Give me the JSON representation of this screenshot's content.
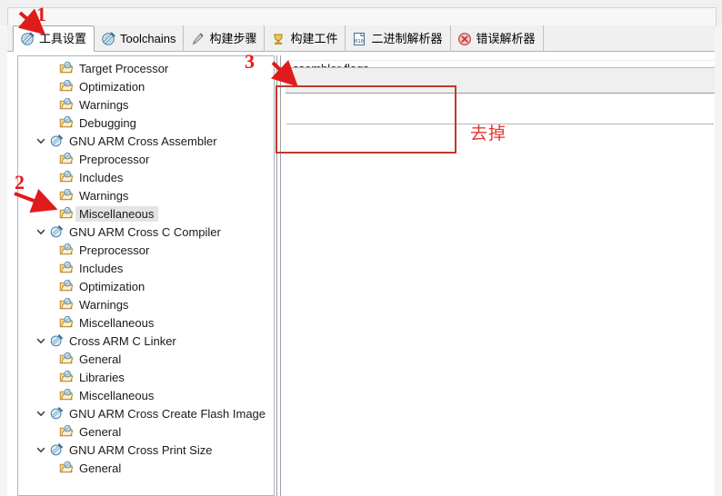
{
  "tabs": [
    {
      "label": "工具设置",
      "icon": "tool-settings-icon",
      "selected": true
    },
    {
      "label": "Toolchains",
      "icon": "toolchains-icon",
      "selected": false
    },
    {
      "label": "构建步骤",
      "icon": "build-steps-icon",
      "selected": false
    },
    {
      "label": "构建工件",
      "icon": "build-artifact-icon",
      "selected": false
    },
    {
      "label": "二进制解析器",
      "icon": "binary-parser-icon",
      "selected": false
    },
    {
      "label": "错误解析器",
      "icon": "error-parser-icon",
      "selected": false
    }
  ],
  "tree": [
    {
      "label": "Target Processor",
      "level": 2,
      "icon": "folder-icon",
      "twisty": "none",
      "selected": false
    },
    {
      "label": "Optimization",
      "level": 2,
      "icon": "folder-icon",
      "twisty": "none",
      "selected": false
    },
    {
      "label": "Warnings",
      "level": 2,
      "icon": "folder-icon",
      "twisty": "none",
      "selected": false
    },
    {
      "label": "Debugging",
      "level": 2,
      "icon": "folder-icon",
      "twisty": "none",
      "selected": false
    },
    {
      "label": "GNU ARM Cross Assembler",
      "level": 1,
      "icon": "toolchain-icon",
      "twisty": "expanded",
      "selected": false
    },
    {
      "label": "Preprocessor",
      "level": 2,
      "icon": "folder-icon",
      "twisty": "none",
      "selected": false
    },
    {
      "label": "Includes",
      "level": 2,
      "icon": "folder-icon",
      "twisty": "none",
      "selected": false
    },
    {
      "label": "Warnings",
      "level": 2,
      "icon": "folder-icon",
      "twisty": "none",
      "selected": false
    },
    {
      "label": "Miscellaneous",
      "level": 2,
      "icon": "folder-icon",
      "twisty": "none",
      "selected": true
    },
    {
      "label": "GNU ARM Cross C Compiler",
      "level": 1,
      "icon": "toolchain-icon",
      "twisty": "expanded",
      "selected": false
    },
    {
      "label": "Preprocessor",
      "level": 2,
      "icon": "folder-icon",
      "twisty": "none",
      "selected": false
    },
    {
      "label": "Includes",
      "level": 2,
      "icon": "folder-icon",
      "twisty": "none",
      "selected": false
    },
    {
      "label": "Optimization",
      "level": 2,
      "icon": "folder-icon",
      "twisty": "none",
      "selected": false
    },
    {
      "label": "Warnings",
      "level": 2,
      "icon": "folder-icon",
      "twisty": "none",
      "selected": false
    },
    {
      "label": "Miscellaneous",
      "level": 2,
      "icon": "folder-icon",
      "twisty": "none",
      "selected": false
    },
    {
      "label": "Cross ARM C Linker",
      "level": 1,
      "icon": "toolchain-icon",
      "twisty": "expanded",
      "selected": false
    },
    {
      "label": "General",
      "level": 2,
      "icon": "folder-icon",
      "twisty": "none",
      "selected": false
    },
    {
      "label": "Libraries",
      "level": 2,
      "icon": "folder-icon",
      "twisty": "none",
      "selected": false
    },
    {
      "label": "Miscellaneous",
      "level": 2,
      "icon": "folder-icon",
      "twisty": "none",
      "selected": false
    },
    {
      "label": "GNU ARM Cross Create Flash Image",
      "level": 1,
      "icon": "toolchain-icon",
      "twisty": "expanded",
      "selected": false
    },
    {
      "label": "General",
      "level": 2,
      "icon": "folder-icon",
      "twisty": "none",
      "selected": false
    },
    {
      "label": "GNU ARM Cross Print Size",
      "level": 1,
      "icon": "toolchain-icon",
      "twisty": "expanded",
      "selected": false
    },
    {
      "label": "General",
      "level": 2,
      "icon": "folder-icon",
      "twisty": "none",
      "selected": false
    }
  ],
  "right_panel": {
    "field_label": "ssembler flags",
    "flags_value": ""
  },
  "annotations": {
    "marker_1": "1",
    "marker_2": "2",
    "marker_3": "3",
    "note_text": "去掉"
  },
  "colors": {
    "annotation_red": "#e01b1b",
    "rect_red": "#c0392b",
    "note_red": "#e8342a",
    "selection_grey": "#e4e4e4",
    "panel_border": "#b0b4b8"
  }
}
